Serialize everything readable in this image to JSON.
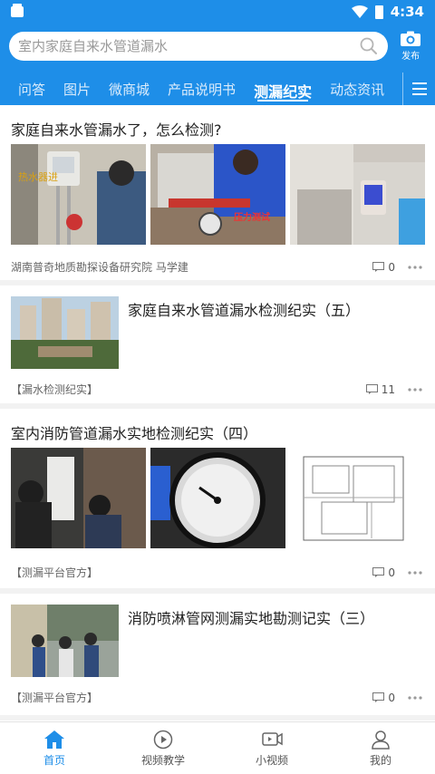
{
  "status_bar": {
    "time": "4:34"
  },
  "search": {
    "placeholder": "室内家庭自来水管道漏水",
    "publish_label": "发布"
  },
  "tabs": [
    {
      "label": "问答"
    },
    {
      "label": "图片"
    },
    {
      "label": "微商城"
    },
    {
      "label": "产品说明书"
    },
    {
      "label": "测漏纪实",
      "active": true
    },
    {
      "label": "动态资讯"
    }
  ],
  "feed": [
    {
      "title": "家庭自来水管漏水了，怎么检测?",
      "source": "湖南普奇地质勘探设备研究院 马学建",
      "comments": "0",
      "image_labels": [
        "热水器进",
        "压力测试"
      ]
    },
    {
      "title": "家庭自来水管道漏水检测纪实（五）",
      "source": "【漏水检测纪实】",
      "comments": "11"
    },
    {
      "title": "室内消防管道漏水实地检测纪实（四）",
      "source": "【测漏平台官方】",
      "comments": "0"
    },
    {
      "title": "消防喷淋管网测漏实地勘测记实（三）",
      "source": "【测漏平台官方】",
      "comments": "0"
    }
  ],
  "bottom_nav": [
    {
      "label": "首页",
      "icon": "home-icon",
      "active": true
    },
    {
      "label": "视频教学",
      "icon": "play-circle-icon"
    },
    {
      "label": "小视频",
      "icon": "video-icon"
    },
    {
      "label": "我的",
      "icon": "user-icon"
    }
  ],
  "colors": {
    "accent": "#1e8ee8",
    "divider": "#f2f2f2"
  }
}
